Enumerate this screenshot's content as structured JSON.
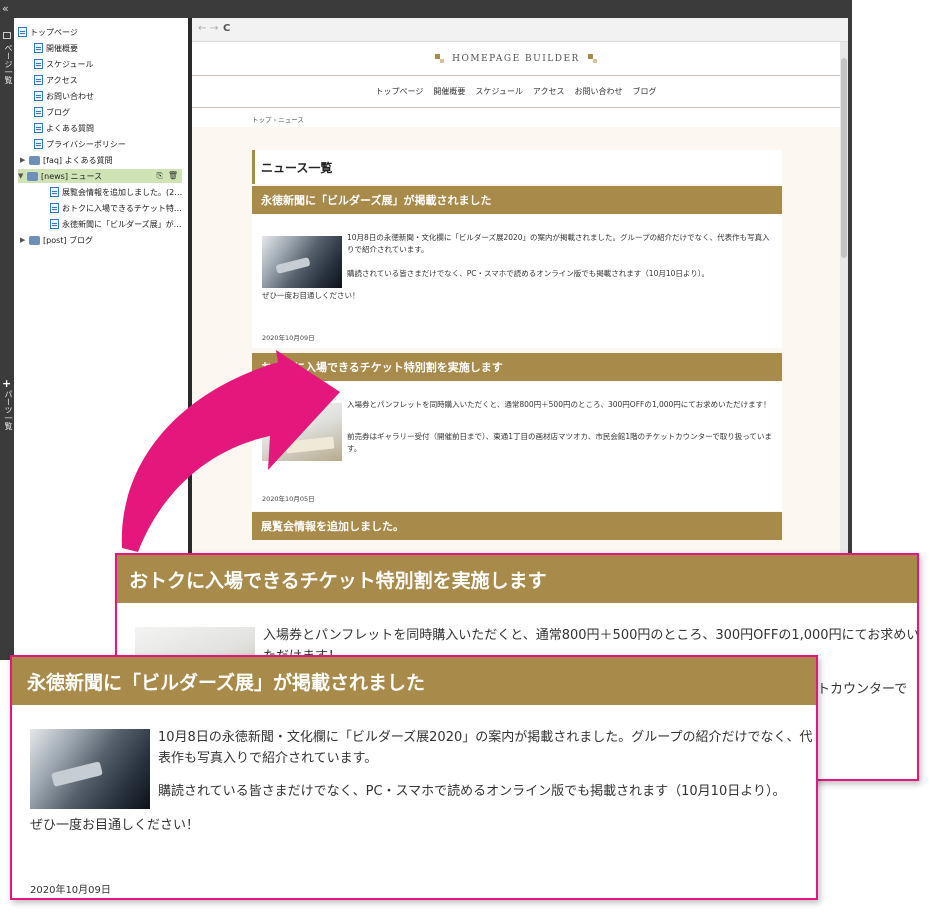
{
  "rail": {
    "collapse_glyph": "«",
    "pages_label": "ページ一覧",
    "plus_glyph": "+",
    "parts_label": "パーツ一覧"
  },
  "tree": {
    "items": [
      {
        "label": "トップページ"
      },
      {
        "label": "開催概要"
      },
      {
        "label": "スケジュール"
      },
      {
        "label": "アクセス"
      },
      {
        "label": "お問い合わせ"
      },
      {
        "label": "ブログ"
      },
      {
        "label": "よくある質問"
      },
      {
        "label": "プライバシーポリシー"
      },
      {
        "label": "[faq] よくある質問"
      },
      {
        "label": "[news] ニュース"
      },
      {
        "label": "展覧会情報を追加しました。(202..."
      },
      {
        "label": "おトクに入場できるチケット特別割..."
      },
      {
        "label": "永徳新聞に「ビルダーズ展」が掲..."
      },
      {
        "label": "[post] ブログ"
      }
    ],
    "tool_copy": "⎘",
    "tool_delete": "🗑"
  },
  "browser": {
    "back": "←",
    "forward": "→",
    "reload": "C"
  },
  "site": {
    "logo": "HOMEPAGE BUILDER",
    "nav": [
      "トップページ",
      "開催概要",
      "スケジュール",
      "アクセス",
      "お問い合わせ",
      "ブログ"
    ],
    "breadcrumb": "トップ › ニュース",
    "page_title": "ニュース一覧",
    "articles": [
      {
        "title": "永徳新聞に「ビルダーズ展」が掲載されました",
        "p1": "10月8日の永徳新聞・文化欄に「ビルダーズ展2020」の案内が掲載されました。グループの紹介だけでなく、代表作も写真入りで紹介されています。",
        "p1a": "10月8日の永徳新聞・文化欄に「ビルダーズ展2020」の案内が掲載されました。グループの紹介だけでなく、代",
        "p1b": "表作も写真入りで紹介されています。",
        "p2": "購読されている皆さまだけでなく、PC・スマホで読めるオンライン版でも掲載されます（10月10日より）。",
        "p3": "ぜひ一度お目通しください！",
        "date": "2020年10月09日"
      },
      {
        "title": "おトクに入場できるチケット特別割を実施します",
        "p1": "入場券とパンフレットを同時購入いただくと、通常800円＋500円のところ、300円OFFの1,000円にてお求めいただけます！",
        "p1a": "入場券とパンフレットを同時購入いただくと、通常800円＋500円のところ、300円OFFの1,000円にてお求めい",
        "p1b": "ただけます！",
        "p2": "前売券はギャラリー受付（開催前日まで）、東通1丁目の画材店マツオカ、市民会館1階のチケットカウンターで取り扱っています。",
        "p2a": "前売券はギャラリー受付（開催前日まで）、東通1丁目の画材店マツオカ、市民会館1階のチケットカウンターで",
        "p2b": "取り扱っています。",
        "p2_tail": "トカウンターで",
        "date": "2020年10月05日"
      },
      {
        "title": "展覧会情報を追加しました。"
      }
    ]
  },
  "colors": {
    "accent_gold": "#a88a4a",
    "callout_border": "#e4187c",
    "arrow": "#e4187c",
    "selected_row": "#cfe3b4"
  }
}
